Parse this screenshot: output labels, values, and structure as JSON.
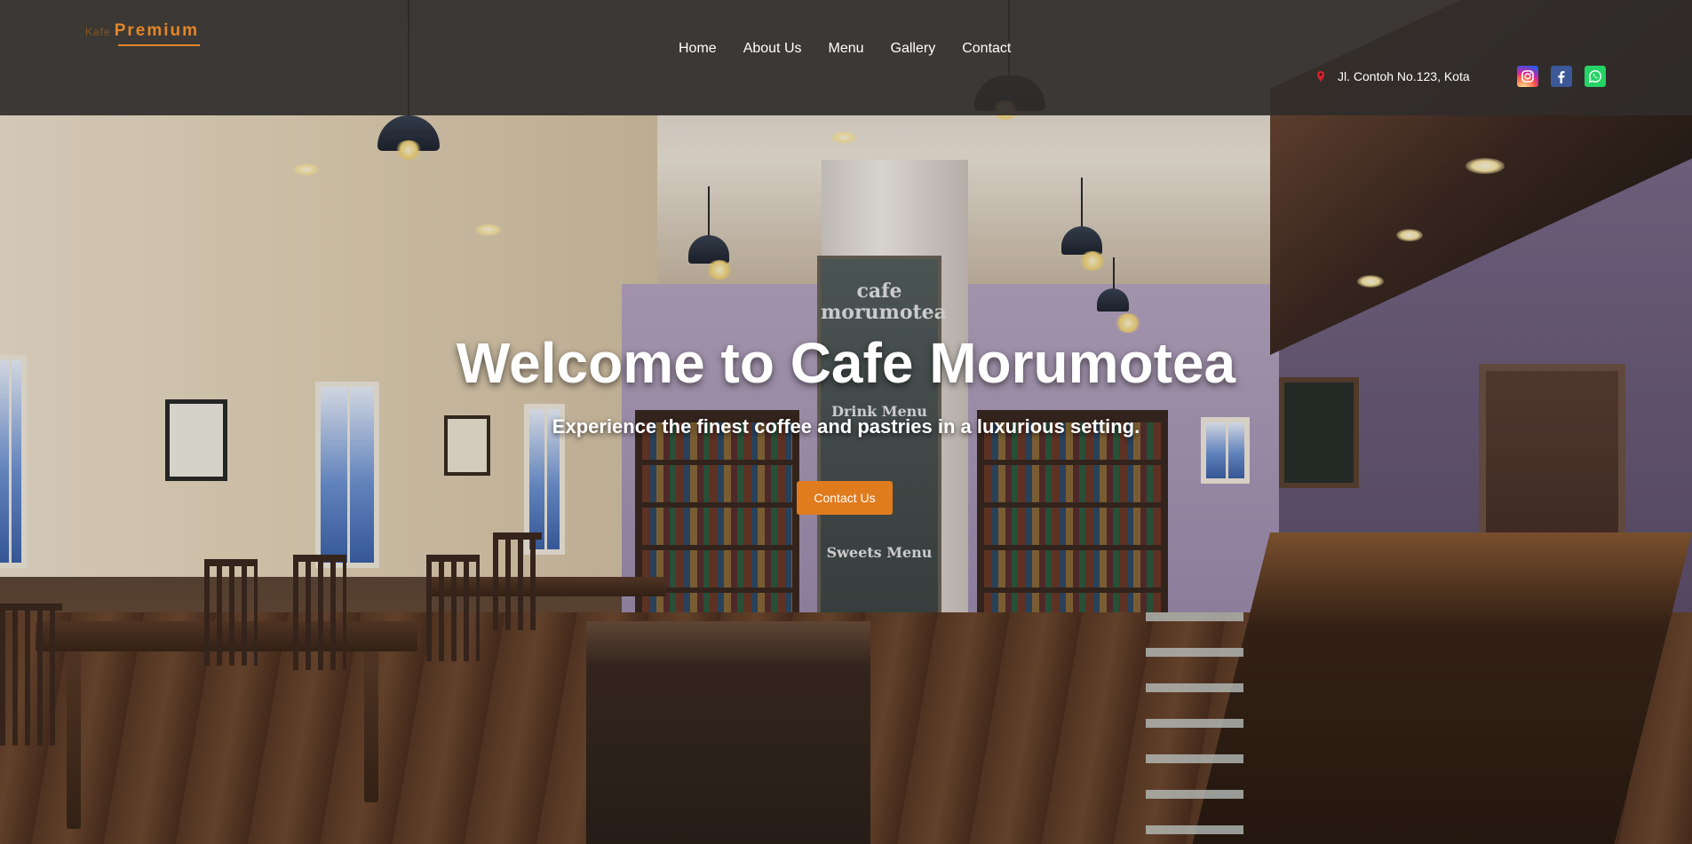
{
  "header": {
    "logo_small": "Kafe",
    "logo_main": "Premium",
    "nav": [
      "Home",
      "About Us",
      "Menu",
      "Gallery",
      "Contact"
    ],
    "address": "Jl. Contoh No.123, Kota",
    "address_icon": "map-pin-icon",
    "socials": [
      {
        "name": "instagram-icon",
        "color": "#d6249f"
      },
      {
        "name": "facebook-icon",
        "color": "#3b5998"
      },
      {
        "name": "whatsapp-icon",
        "color": "#25d366"
      }
    ]
  },
  "hero": {
    "title": "Welcome to Cafe Morumotea",
    "subtitle": "Experience the finest coffee and pastries in a luxurious setting.",
    "cta_label": "Contact Us",
    "accent": "#e07b1e",
    "board_title": "cafe morumotea",
    "board_menu": "Drink Menu",
    "board_sweets": "Sweets Menu"
  }
}
